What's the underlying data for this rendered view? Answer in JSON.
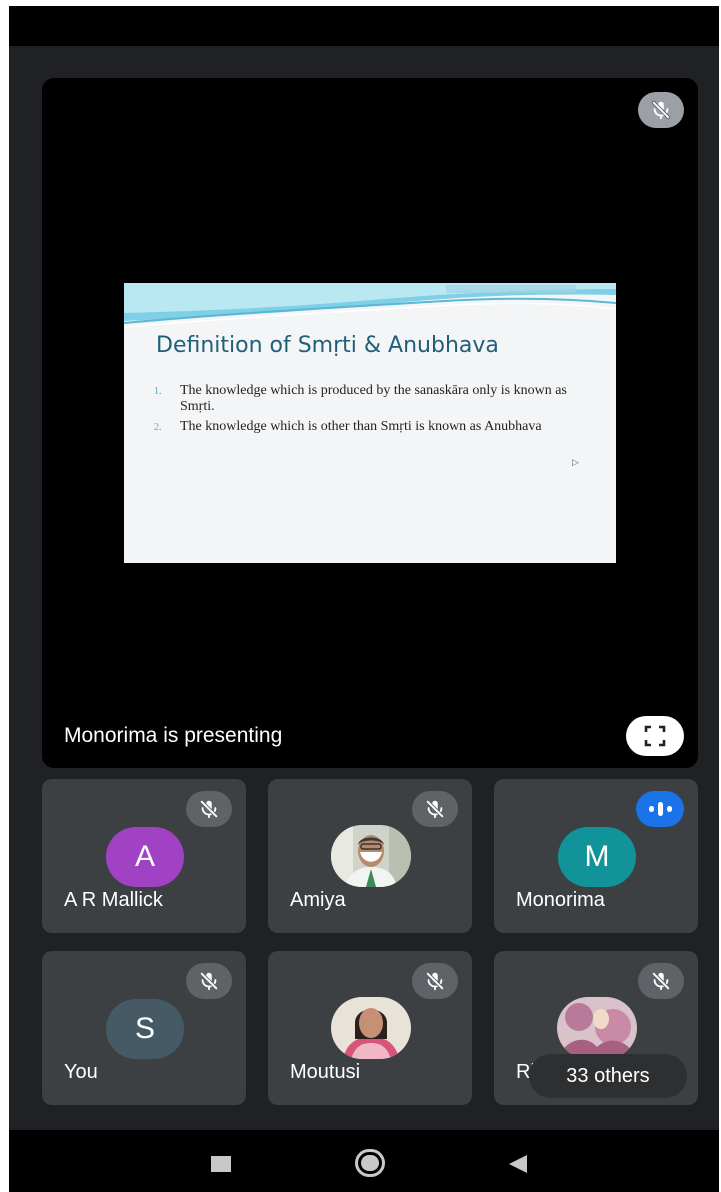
{
  "presentation": {
    "presenting_text": "Monorima is presenting",
    "icons": {
      "mic": "mic-off-icon",
      "fullscreen": "fullscreen-icon"
    },
    "slide": {
      "title": "Definition of Smṛti & Anubhava",
      "items": [
        {
          "num": "1.",
          "text": "The knowledge which is produced by the sanaskāra only is known as Smṛti."
        },
        {
          "num": "2.",
          "text": "The knowledge which is other than Smṛti is known as Anubhava"
        }
      ]
    }
  },
  "participants": [
    {
      "name": "A R Mallick",
      "initial": "A",
      "avatar_color": "#a142c4",
      "mic": "muted"
    },
    {
      "name": "Amiya",
      "initial": "",
      "avatar_color": "",
      "mic": "muted"
    },
    {
      "name": "Monorima",
      "initial": "M",
      "avatar_color": "#12939a",
      "mic": "speaking"
    },
    {
      "name": "You",
      "initial": "S",
      "avatar_color": "#455a64",
      "mic": "muted"
    },
    {
      "name": "Moutusi",
      "initial": "",
      "avatar_color": "",
      "mic": "muted"
    },
    {
      "name": "Ri",
      "initial": "",
      "avatar_color": "",
      "mic": "muted"
    }
  ],
  "others_chip": "33 others",
  "nav": {
    "icons": [
      "recents-icon",
      "home-icon",
      "back-icon"
    ]
  }
}
